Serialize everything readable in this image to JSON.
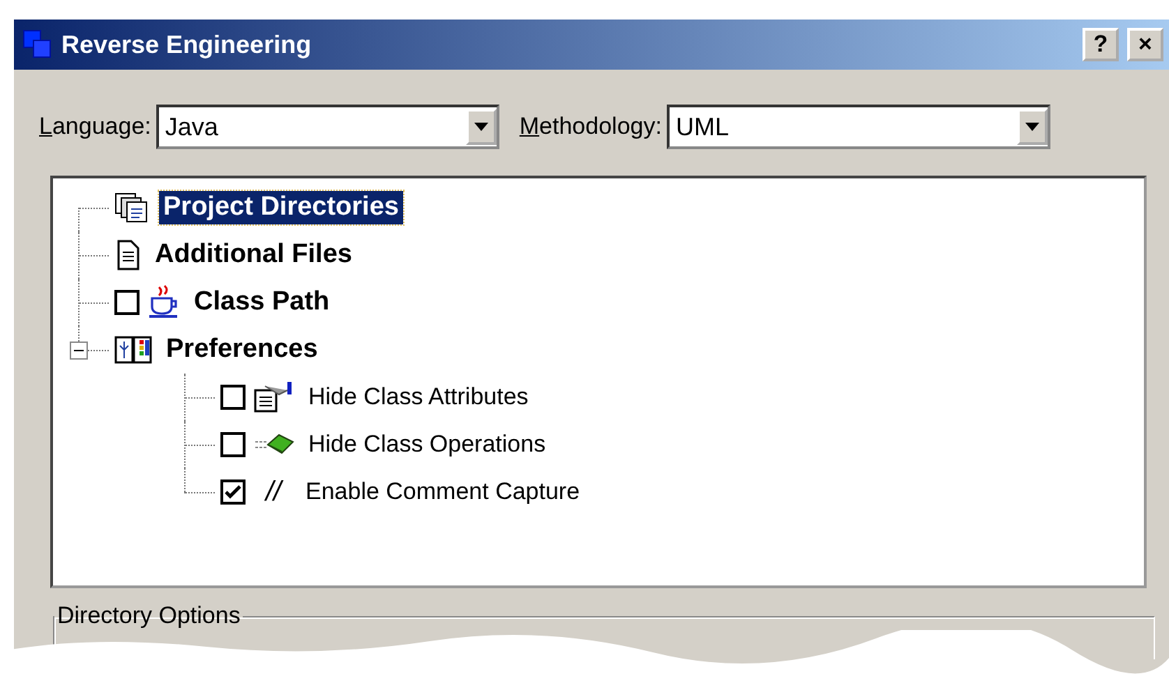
{
  "window": {
    "title": "Reverse Engineering",
    "help_button": "?",
    "close_button": "×"
  },
  "fields": [
    {
      "label": "Language:",
      "value": "Java"
    },
    {
      "label": "Methodology:",
      "value": "UML"
    }
  ],
  "tree": [
    {
      "label": "Project Directories",
      "kind": "directories",
      "selected": true
    },
    {
      "label": "Additional Files",
      "kind": "file",
      "selected": false
    },
    {
      "label": "Class Path",
      "kind": "cup",
      "selected": false,
      "checked": false
    },
    {
      "label": "Preferences",
      "kind": "book",
      "selected": false,
      "expanded": true,
      "children": [
        {
          "label": "Hide Class Attributes",
          "kind": "attributes",
          "selected": false,
          "checked": false
        },
        {
          "label": "Hide Class Operations",
          "kind": "operations",
          "selected": false,
          "checked": false
        },
        {
          "label": "Enable Comment Capture",
          "kind": "comment",
          "glyph": "//",
          "selected": false,
          "checked": true
        }
      ]
    }
  ],
  "group": {
    "title": "Directory Options"
  }
}
